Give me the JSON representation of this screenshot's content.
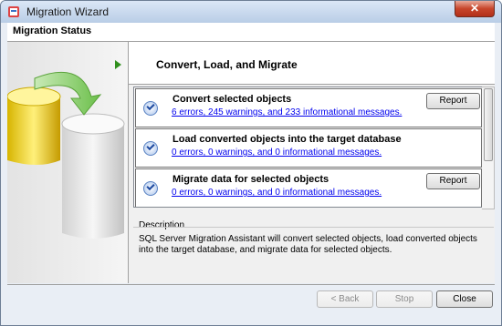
{
  "window": {
    "title": "Migration Wizard",
    "close_label": "✕"
  },
  "header": {
    "section": "Migration Status"
  },
  "step": {
    "title": "Convert, Load, and Migrate"
  },
  "tasks": [
    {
      "name": "Convert selected objects",
      "message": "6 errors, 245 warnings, and 233 informational messages.",
      "report_label": "Report"
    },
    {
      "name": "Load converted objects into the target database",
      "message": "0 errors, 0 warnings, and 0 informational messages."
    },
    {
      "name": "Migrate data for selected objects",
      "message": "0 errors, 0 warnings, and 0 informational messages.",
      "report_label": "Report"
    }
  ],
  "description": {
    "label": "Description",
    "text": "SQL Server Migration Assistant will convert selected objects, load converted objects into the target database, and migrate data for selected objects."
  },
  "buttons": {
    "back": "< Back",
    "stop": "Stop",
    "close": "Close"
  },
  "icons": {
    "app": "sql-migration-icon",
    "check": "check-circle-icon",
    "arrow": "green-play-arrow-icon"
  }
}
